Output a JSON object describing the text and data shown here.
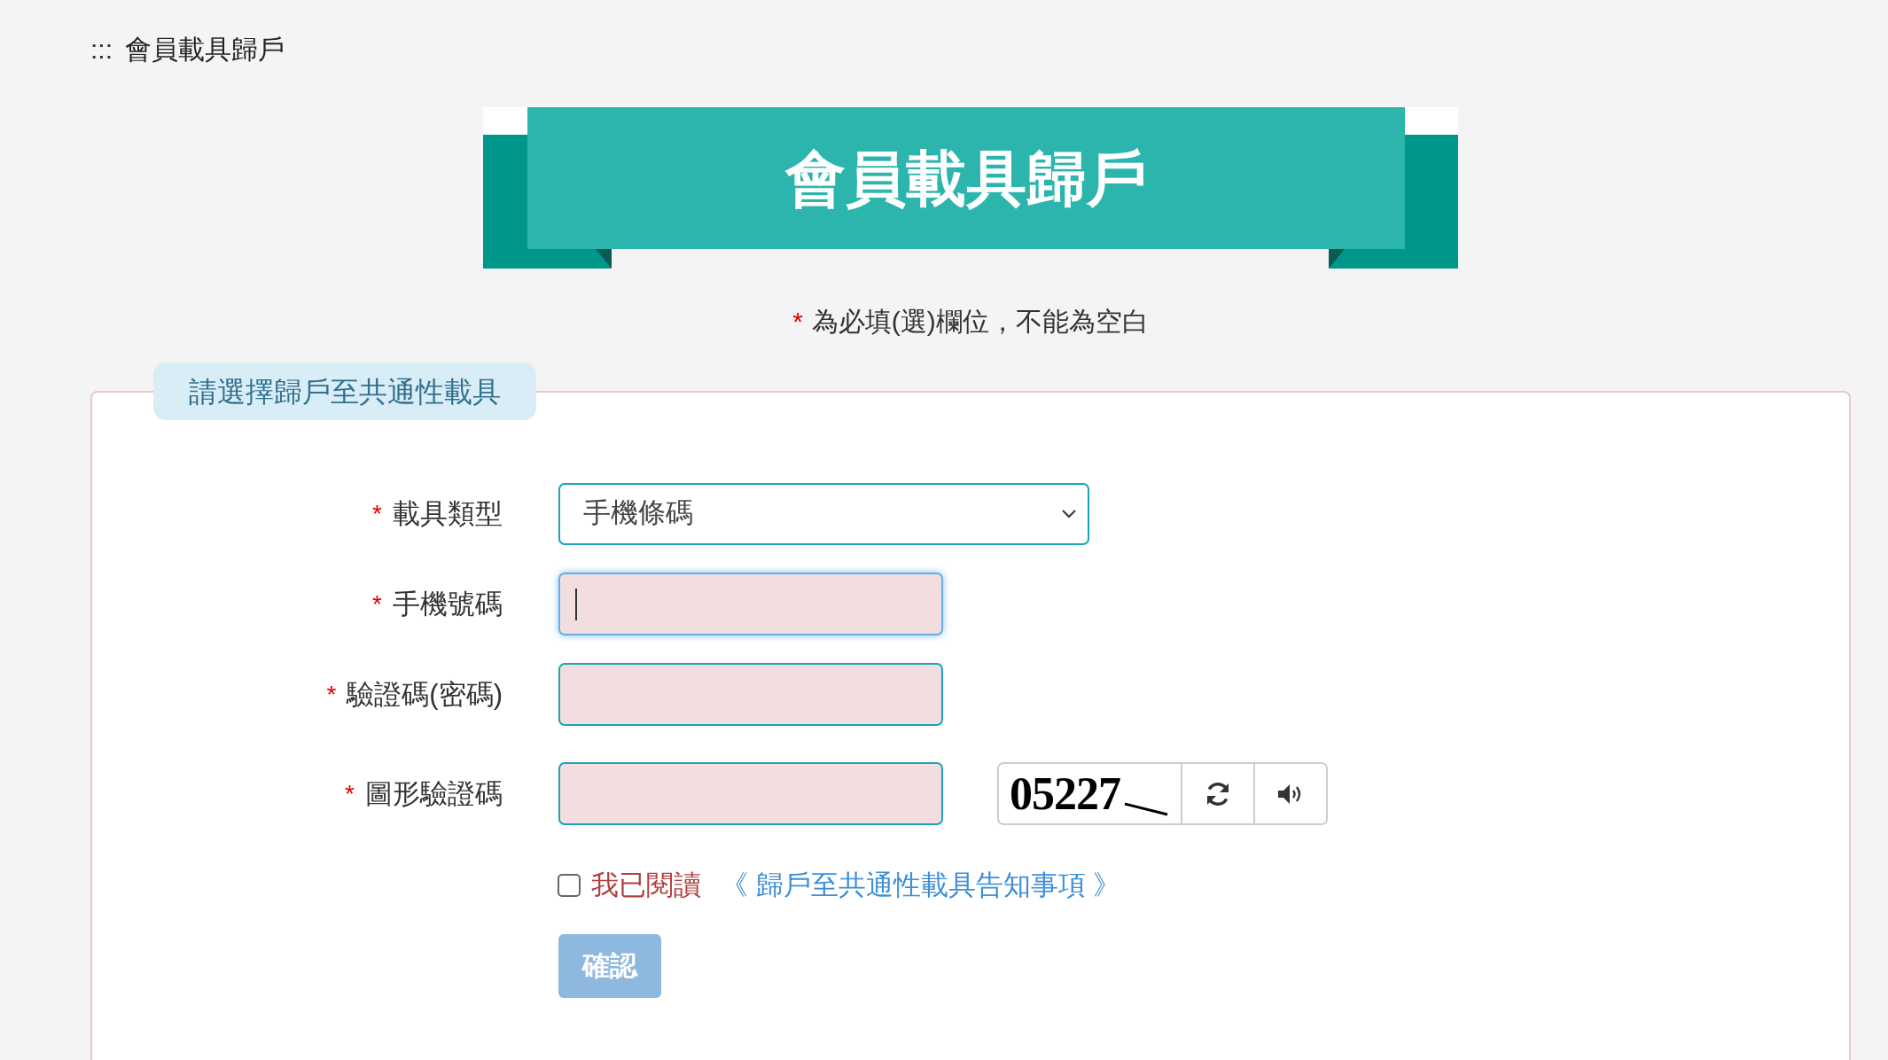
{
  "breadcrumb": {
    "marker": ":::",
    "title": "會員載具歸戶"
  },
  "banner": {
    "title": "會員載具歸戶"
  },
  "required_note": {
    "mark": "*",
    "text": "為必填(選)欄位，不能為空白"
  },
  "section": {
    "legend": "請選擇歸戶至共通性載具",
    "fields": [
      {
        "kind": "select",
        "mark": "*",
        "label": "載具類型",
        "value": "手機條碼"
      },
      {
        "kind": "text",
        "mark": "*",
        "label": "手機號碼",
        "focused": true,
        "error": true
      },
      {
        "kind": "text",
        "mark": "*",
        "label": "驗證碼(密碼)",
        "focused": false,
        "error": true
      },
      {
        "kind": "captcha",
        "mark": "*",
        "label": "圖形驗證碼",
        "focused": false,
        "error": true,
        "captcha": "05227"
      }
    ],
    "agreement": {
      "checked": false,
      "text": "我已閱讀",
      "link": "《 歸戶至共通性載具告知事項 》"
    },
    "submit": {
      "label": "確認",
      "disabled": true
    }
  }
}
